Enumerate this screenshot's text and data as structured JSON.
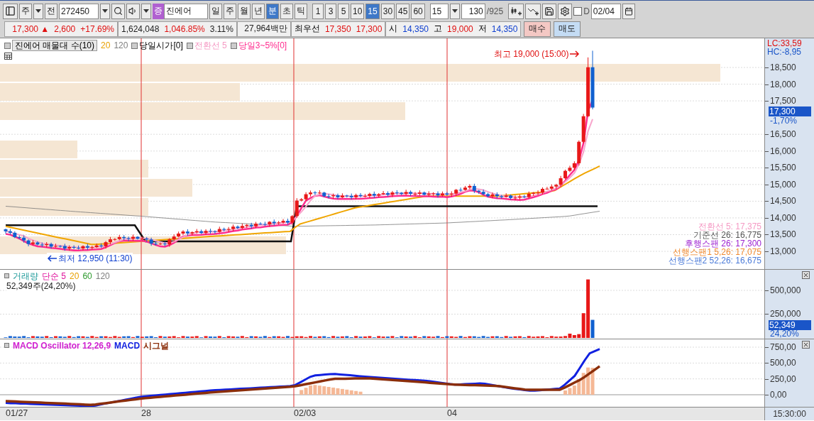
{
  "toolbar": {
    "view_select": "주",
    "prev_button": "전",
    "code": "272450",
    "market_badge": "증",
    "name": "진에어",
    "periods": [
      {
        "label": "일",
        "selected": false
      },
      {
        "label": "주",
        "selected": false
      },
      {
        "label": "월",
        "selected": false
      },
      {
        "label": "년",
        "selected": false
      },
      {
        "label": "분",
        "selected": true
      },
      {
        "label": "초",
        "selected": false
      },
      {
        "label": "틱",
        "selected": false
      }
    ],
    "intervals": [
      {
        "label": "1",
        "selected": false
      },
      {
        "label": "3",
        "selected": false
      },
      {
        "label": "5",
        "selected": false
      },
      {
        "label": "10",
        "selected": false
      },
      {
        "label": "15",
        "selected": true
      },
      {
        "label": "30",
        "selected": false
      },
      {
        "label": "45",
        "selected": false
      },
      {
        "label": "60",
        "selected": false
      }
    ],
    "interval_select": "15",
    "count": "130",
    "total": "/925",
    "date_check": {
      "label": "D",
      "checked": false
    },
    "date": "02/04"
  },
  "quote": {
    "groups": [
      {
        "cells": [
          {
            "text": "17,300 ▲",
            "color": "#e01010"
          },
          {
            "text": "2,600",
            "color": "#e01010"
          },
          {
            "text": "+17.69%",
            "color": "#e01010"
          }
        ]
      },
      {
        "cells": [
          {
            "text": "1,624,048",
            "color": "#222222"
          },
          {
            "text": "1,046.85%",
            "color": "#e01010"
          },
          {
            "text": "3.11%",
            "color": "#222222"
          }
        ]
      },
      {
        "cells": [
          {
            "text": "27,964백만",
            "color": "#222222"
          }
        ]
      },
      {
        "cells": [
          {
            "text": "최우선"
          },
          {
            "text": "17,350",
            "color": "#e01010"
          },
          {
            "text": "17,300",
            "color": "#e01010"
          }
        ]
      },
      {
        "cells": [
          {
            "text": "시"
          },
          {
            "text": "14,350",
            "color": "#1040d0"
          },
          {
            "text": "고"
          },
          {
            "text": "19,000",
            "color": "#e01010"
          },
          {
            "text": "저"
          },
          {
            "text": "14,350",
            "color": "#1040d0"
          }
        ]
      }
    ],
    "buy": "매수",
    "sell": "매도"
  },
  "price_panel": {
    "legend": [
      {
        "text": "진에어 매물대 수(10)",
        "color": "#000000",
        "marker": true,
        "boxed": true
      },
      {
        "text": "20",
        "color": "#e8a000",
        "marker": false,
        "boxed": false
      },
      {
        "text": "120",
        "color": "#808080",
        "marker": false,
        "boxed": false
      },
      {
        "text": "당일시가[0]",
        "color": "#000000",
        "marker": true,
        "boxed": false
      },
      {
        "text": "전환선 5",
        "color": "#f59ac4",
        "marker": true,
        "boxed": false
      },
      {
        "text": "당일3~5%[0]",
        "color": "#ff2d8f",
        "marker": true,
        "boxed": false
      }
    ],
    "high_note": "최고 19,000 (15:00)",
    "low_note": "최저 12,950 (11:30)",
    "lc": "LC:33,59",
    "hc": "HC:-8,95",
    "ticks": [
      "18,500",
      "18,000",
      "17,500",
      "16,500",
      "16,000",
      "15,500",
      "15,000",
      "14,500",
      "14,000",
      "13,500",
      "13,000"
    ],
    "price_badge": "17,300",
    "price_change": "-1,70%",
    "values": [
      {
        "text": "전환선 5: 17,375",
        "color": "#f59ac4"
      },
      {
        "text": "기준선 26: 16,775",
        "color": "#555555"
      },
      {
        "text": "후행스팬 26: 17,300",
        "color": "#9b1fd0"
      },
      {
        "text": "선행스팬1 5,26: 17,075",
        "color": "#f08a30"
      },
      {
        "text": "선행스팬2 52,26: 16,675",
        "color": "#4a7ad8"
      }
    ]
  },
  "volume_panel": {
    "legend": [
      {
        "text": "거래량",
        "color": "#1f9a9a"
      },
      {
        "text": "단순 5",
        "color": "#e0139c"
      },
      {
        "text": "20",
        "color": "#e8a000"
      },
      {
        "text": "60",
        "color": "#2e9a2e"
      },
      {
        "text": "120",
        "color": "#808080"
      }
    ],
    "summary": "52,349주(24,20%)",
    "ticks": [
      "500,000",
      "250,000"
    ],
    "badge": "52,349",
    "badge_pct": "24,20%"
  },
  "macd_panel": {
    "legend": [
      {
        "text": "MACD Oscillator 12,26,9",
        "color": "#d01fd0"
      },
      {
        "text": "MACD",
        "color": "#1020e0"
      },
      {
        "text": "시그널",
        "color": "#8b2e0a"
      }
    ],
    "ticks": [
      "750,00",
      "500,00",
      "250,00",
      "0,00"
    ]
  },
  "x_axis": {
    "labels": [
      "01/27",
      "28",
      "02/03",
      "04"
    ],
    "time": "15:30:00"
  }
}
